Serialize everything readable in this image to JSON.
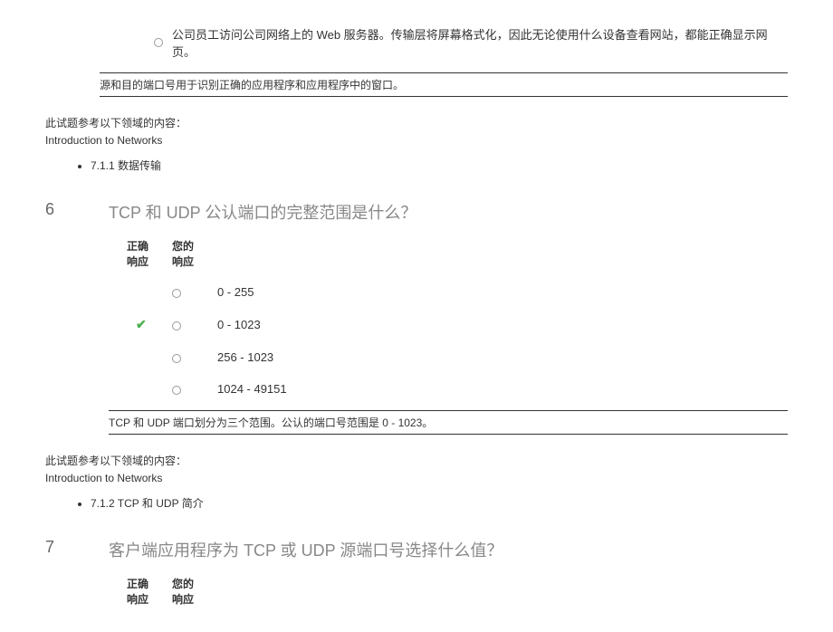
{
  "prev_question": {
    "option_text": "公司员工访问公司网络上的 Web 服务器。传输层将屏幕格式化，因此无论使用什么设备查看网站，都能正确显示网页。",
    "explanation": "源和目的端口号用于识别正确的应用程序和应用程序中的窗口。"
  },
  "reference1": {
    "label": "此试题参考以下领域的内容：",
    "module": "Introduction to Networks",
    "topic": "7.1.1 数据传输"
  },
  "question6": {
    "number": "6",
    "title": "TCP 和 UDP 公认端口的完整范围是什么？",
    "header_correct": "正确",
    "header_response_line1": "响应",
    "header_your": "您的",
    "header_response_line2": "响应",
    "options": [
      {
        "text": "0 - 255",
        "correct": false
      },
      {
        "text": "0 - 1023",
        "correct": true
      },
      {
        "text": "256 - 1023",
        "correct": false
      },
      {
        "text": "1024 - 49151",
        "correct": false
      }
    ],
    "explanation": "TCP 和 UDP 端口划分为三个范围。公认的端口号范围是 0 - 1023。"
  },
  "reference2": {
    "label": "此试题参考以下领域的内容：",
    "module": "Introduction to Networks",
    "topic": "7.1.2 TCP 和 UDP 简介"
  },
  "question7": {
    "number": "7",
    "title": "客户端应用程序为 TCP 或 UDP 源端口号选择什么值？",
    "header_correct": "正确",
    "header_response_line1": "响应",
    "header_your": "您的",
    "header_response_line2": "响应"
  }
}
